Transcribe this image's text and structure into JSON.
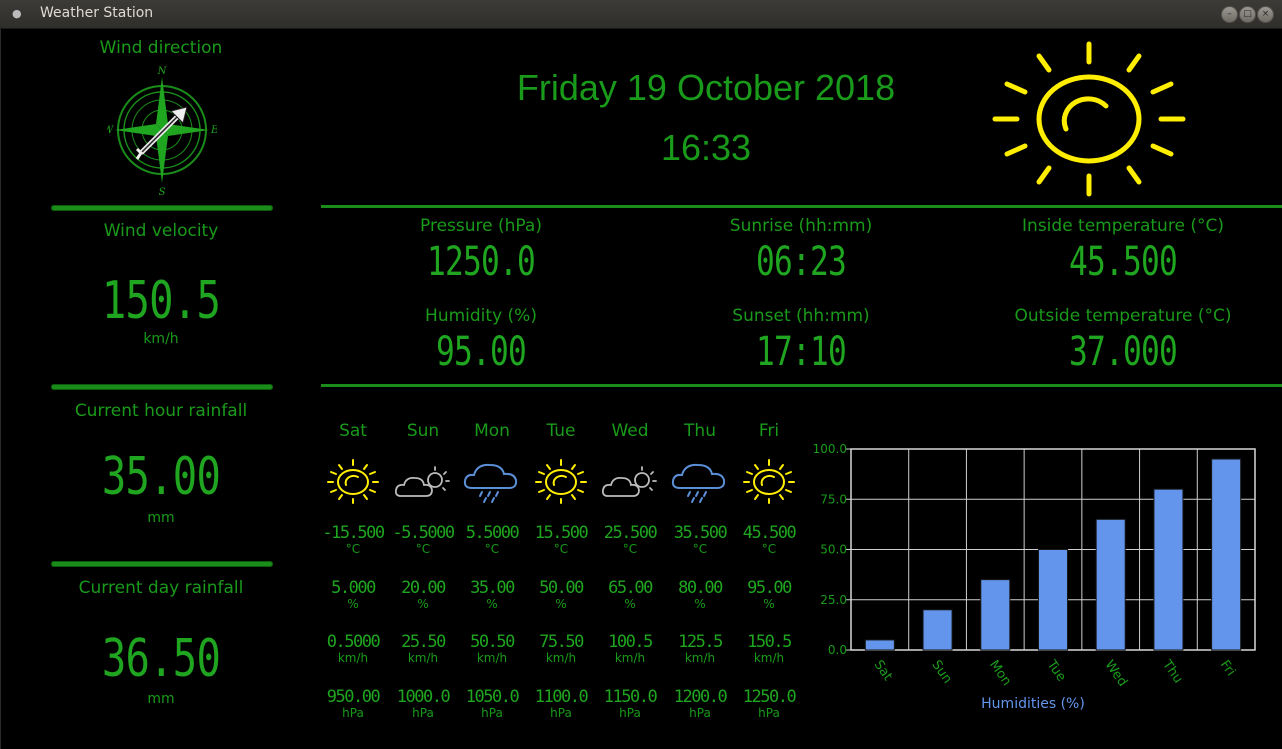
{
  "window": {
    "title": "Weather Station"
  },
  "wind": {
    "direction_label": "Wind direction",
    "compass": {
      "n": "N",
      "e": "E",
      "s": "S",
      "w": "W"
    },
    "velocity_label": "Wind velocity",
    "velocity_value": "150.5",
    "velocity_unit": "km/h"
  },
  "rainfall": {
    "hour_label": "Current hour rainfall",
    "hour_value": "35.00",
    "hour_unit": "mm",
    "day_label": "Current day rainfall",
    "day_value": "36.50",
    "day_unit": "mm"
  },
  "header": {
    "date": "Friday 19 October 2018",
    "time": "16:33",
    "current_icon": "sun-icon"
  },
  "readings": {
    "pressure_label": "Pressure (hPa)",
    "pressure_value": "1250.0",
    "sunrise_label": "Sunrise (hh:mm)",
    "sunrise_value": "06:23",
    "inside_label": "Inside temperature (°C)",
    "inside_value": "45.500",
    "humidity_label": "Humidity (%)",
    "humidity_value": "95.00",
    "sunset_label": "Sunset (hh:mm)",
    "sunset_value": "17:10",
    "outside_label": "Outside temperature (°C)",
    "outside_value": "37.000"
  },
  "forecast": [
    {
      "day": "Sat",
      "icon": "sun-icon",
      "temp": "-15.500",
      "temp_unit": "°C",
      "hum": "5.000",
      "hum_unit": "%",
      "wind": "0.5000",
      "wind_unit": "km/h",
      "press": "950.00",
      "press_unit": "hPa"
    },
    {
      "day": "Sun",
      "icon": "cloudy-icon",
      "temp": "-5.5000",
      "temp_unit": "°C",
      "hum": "20.00",
      "hum_unit": "%",
      "wind": "25.50",
      "wind_unit": "km/h",
      "press": "1000.0",
      "press_unit": "hPa"
    },
    {
      "day": "Mon",
      "icon": "rain-icon",
      "temp": "5.5000",
      "temp_unit": "°C",
      "hum": "35.00",
      "hum_unit": "%",
      "wind": "50.50",
      "wind_unit": "km/h",
      "press": "1050.0",
      "press_unit": "hPa"
    },
    {
      "day": "Tue",
      "icon": "sun-icon",
      "temp": "15.500",
      "temp_unit": "°C",
      "hum": "50.00",
      "hum_unit": "%",
      "wind": "75.50",
      "wind_unit": "km/h",
      "press": "1100.0",
      "press_unit": "hPa"
    },
    {
      "day": "Wed",
      "icon": "cloudy-icon",
      "temp": "25.500",
      "temp_unit": "°C",
      "hum": "65.00",
      "hum_unit": "%",
      "wind": "100.5",
      "wind_unit": "km/h",
      "press": "1150.0",
      "press_unit": "hPa"
    },
    {
      "day": "Thu",
      "icon": "rain-icon",
      "temp": "35.500",
      "temp_unit": "°C",
      "hum": "80.00",
      "hum_unit": "%",
      "wind": "125.5",
      "wind_unit": "km/h",
      "press": "1200.0",
      "press_unit": "hPa"
    },
    {
      "day": "Fri",
      "icon": "sun-icon",
      "temp": "45.500",
      "temp_unit": "°C",
      "hum": "95.00",
      "hum_unit": "%",
      "wind": "150.5",
      "wind_unit": "km/h",
      "press": "1250.0",
      "press_unit": "hPa"
    }
  ],
  "chart_data": {
    "type": "bar",
    "categories": [
      "Sat",
      "Sun",
      "Mon",
      "Tue",
      "Wed",
      "Thu",
      "Fri"
    ],
    "values": [
      5,
      20,
      35,
      50,
      65,
      80,
      95
    ],
    "xlabel": "Humidities (%)",
    "ylim": [
      0,
      100
    ],
    "yticks": [
      "0.0",
      "25.0",
      "50.0",
      "75.0",
      "100.0"
    ],
    "grid": true,
    "bar_color": "#6495ed"
  },
  "colors": {
    "accent": "#1a9a1a",
    "sun": "#ffee00",
    "bar": "#6495ed"
  }
}
